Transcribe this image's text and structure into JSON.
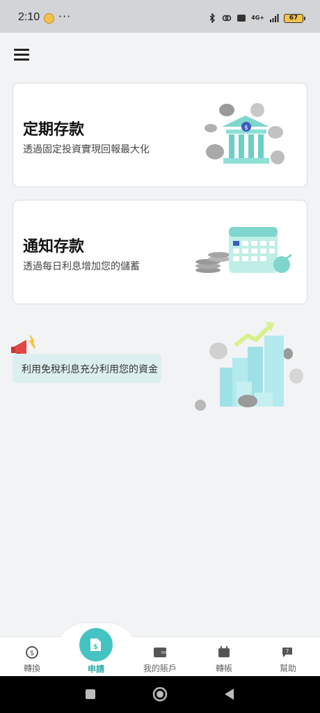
{
  "status_bar": {
    "time": "2:10",
    "dots": "···",
    "network": "4G+",
    "battery": "67"
  },
  "menu": {
    "icon": "hamburger-menu-icon"
  },
  "products": [
    {
      "title": "定期存款",
      "description": "透過固定投資實現回報最大化",
      "illustration": "bank-coins-illustration"
    },
    {
      "title": "通知存款",
      "description": "透過每日利息增加您的儲蓄",
      "illustration": "calendar-coins-illustration"
    }
  ],
  "promo": {
    "text": "利用免稅利息充分利用您的資金",
    "icon": "megaphone-icon",
    "illustration": "growth-chart-illustration"
  },
  "tabs": [
    {
      "label": "轉換",
      "icon": "exchange-icon"
    },
    {
      "label": "申請",
      "icon": "application-folder-icon",
      "active": true
    },
    {
      "label": "我的賬戶",
      "icon": "wallet-icon"
    },
    {
      "label": "轉帳",
      "icon": "transfer-icon"
    },
    {
      "label": "幫助",
      "icon": "help-chat-icon"
    }
  ],
  "colors": {
    "accent": "#45c3c3",
    "background": "#f2f3f5",
    "teal_light": "#dceff0"
  }
}
